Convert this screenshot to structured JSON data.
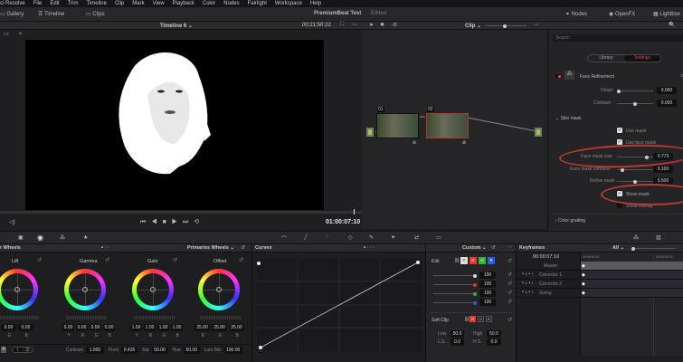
{
  "menubar": [
    "ci Resolve",
    "File",
    "Edit",
    "Trim",
    "Timeline",
    "Clip",
    "Mark",
    "View",
    "Playback",
    "Color",
    "Nodes",
    "Fairlight",
    "Workspace",
    "Help"
  ],
  "toolbar": {
    "gallery": "Gallery",
    "timeline": "Timeline",
    "clips": "Clips",
    "project_title": "PremiumBeat Test",
    "status": "Edited",
    "nodes": "Nodes",
    "openfx": "OpenFX",
    "lightbox": "Lightbox"
  },
  "viewer": {
    "timeline_name": "Timeline 6",
    "source_timecode": "00:21:50:22",
    "timecode": "01:00:07:10"
  },
  "node_editor": {
    "mode": "Clip",
    "nodes": [
      {
        "label": "01"
      },
      {
        "label": "02"
      }
    ]
  },
  "openfx": {
    "search_placeholder": "Search",
    "tabs": [
      "Library",
      "Settings"
    ],
    "active_tab": "Settings",
    "effect_name": "Face Refinement",
    "params": [
      {
        "label": "Detail",
        "value": "0.000"
      },
      {
        "label": "Contrast",
        "value": "0.000"
      }
    ],
    "skin_mask": {
      "section": "Skin mask",
      "use_mask": "Use mask",
      "use_face_mask": "Use face mask",
      "sliders": [
        {
          "label": "Face mask size",
          "value": "0.773"
        },
        {
          "label": "Face mask softness",
          "value": "0.100"
        },
        {
          "label": "Refine mask",
          "value": "0.500"
        }
      ],
      "show_mask": "Show mask",
      "show_overlay": "Show overlay"
    },
    "color_grading": "Color grading"
  },
  "wheels": {
    "title": "r Wheels",
    "mode": "Primaries Wheels",
    "items": [
      {
        "name": "Lift",
        "values": [
          "0.00",
          "0.00",
          "0.00"
        ],
        "labels": [
          "R",
          "G",
          "B"
        ]
      },
      {
        "name": "Gamma",
        "values": [
          "0.00",
          "0.00",
          "0.00",
          "0.00"
        ],
        "labels": [
          "Y",
          "R",
          "G",
          "B"
        ]
      },
      {
        "name": "Gain",
        "values": [
          "1.00",
          "1.00",
          "1.00",
          "1.00"
        ],
        "labels": [
          "Y",
          "R",
          "G",
          "B"
        ]
      },
      {
        "name": "Offset",
        "values": [
          "25.00",
          "25.00",
          "25.00"
        ],
        "labels": [
          "R",
          "G",
          "B"
        ]
      }
    ],
    "page1": "1",
    "page2": "2",
    "contrast_label": "Contrast",
    "contrast": "1.000",
    "pivot_label": "Pivot",
    "pivot": "0.435",
    "sat_label": "Sat",
    "sat": "50.00",
    "hue_label": "Hue",
    "hue": "50.00",
    "lummix_label": "Lum Mix",
    "lummix": "100.00"
  },
  "curves": {
    "title": "Curves",
    "mode": "Custom"
  },
  "edit": {
    "title": "Edit",
    "channels": [
      "Y",
      "R",
      "G",
      "B"
    ],
    "values": [
      "100",
      "100",
      "100",
      "100"
    ],
    "soft_clip": "Soft Clip",
    "low_label": "Low",
    "low": "50.0",
    "high_label": "High",
    "high": "50.0",
    "ls_label": "L.S.",
    "ls": "0.0",
    "hs_label": "H.S.",
    "hs": "0.0"
  },
  "keyframes": {
    "title": "Keyframes",
    "filter": "All",
    "timecode": "00:00:07:10",
    "ruler": [
      "00:00:00:00",
      "00:00:05:03"
    ],
    "tracks": [
      "Master",
      "Corrector 1",
      "Corrector 2",
      "Sizing"
    ]
  },
  "colors": {
    "accent": "#e64b3c",
    "annotation": "#e01010",
    "node_green": "#9acd32"
  }
}
